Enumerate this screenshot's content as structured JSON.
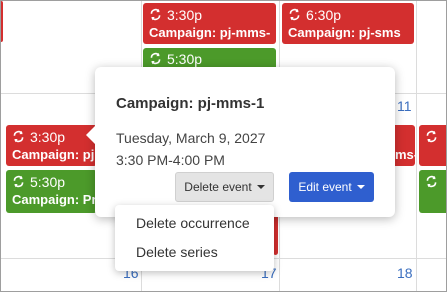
{
  "calendar": {
    "day_numbers": [
      "11",
      "16",
      "17",
      "18"
    ],
    "events": [
      {
        "time": "3:30p",
        "title": "Campaign: pj-mms-"
      },
      {
        "time": "6:30p",
        "title": "Campaign: pj-sms"
      },
      {
        "time": "5:30p",
        "title": ""
      },
      {
        "time": "3:30p",
        "title": "Campaign: pj"
      },
      {
        "time": "5:30p",
        "title": "Campaign: Pr"
      },
      {
        "time": "",
        "title": "ms-"
      }
    ]
  },
  "popover": {
    "title": "Campaign: pj-mms-1",
    "date": "Tuesday, March 9, 2027",
    "time": "3:30 PM-4:00 PM",
    "delete_label": "Delete event",
    "edit_label": "Edit event"
  },
  "delete_menu": {
    "items": [
      "Delete occurrence",
      "Delete series"
    ]
  },
  "colors": {
    "event_red": "#d32f2f",
    "event_green": "#4c9a2a",
    "edit_button": "#2f5fcf",
    "day_number": "#3a6ebf"
  },
  "icons": {
    "event_repeat": "repeat-icon",
    "dropdown": "caret-down-icon"
  }
}
